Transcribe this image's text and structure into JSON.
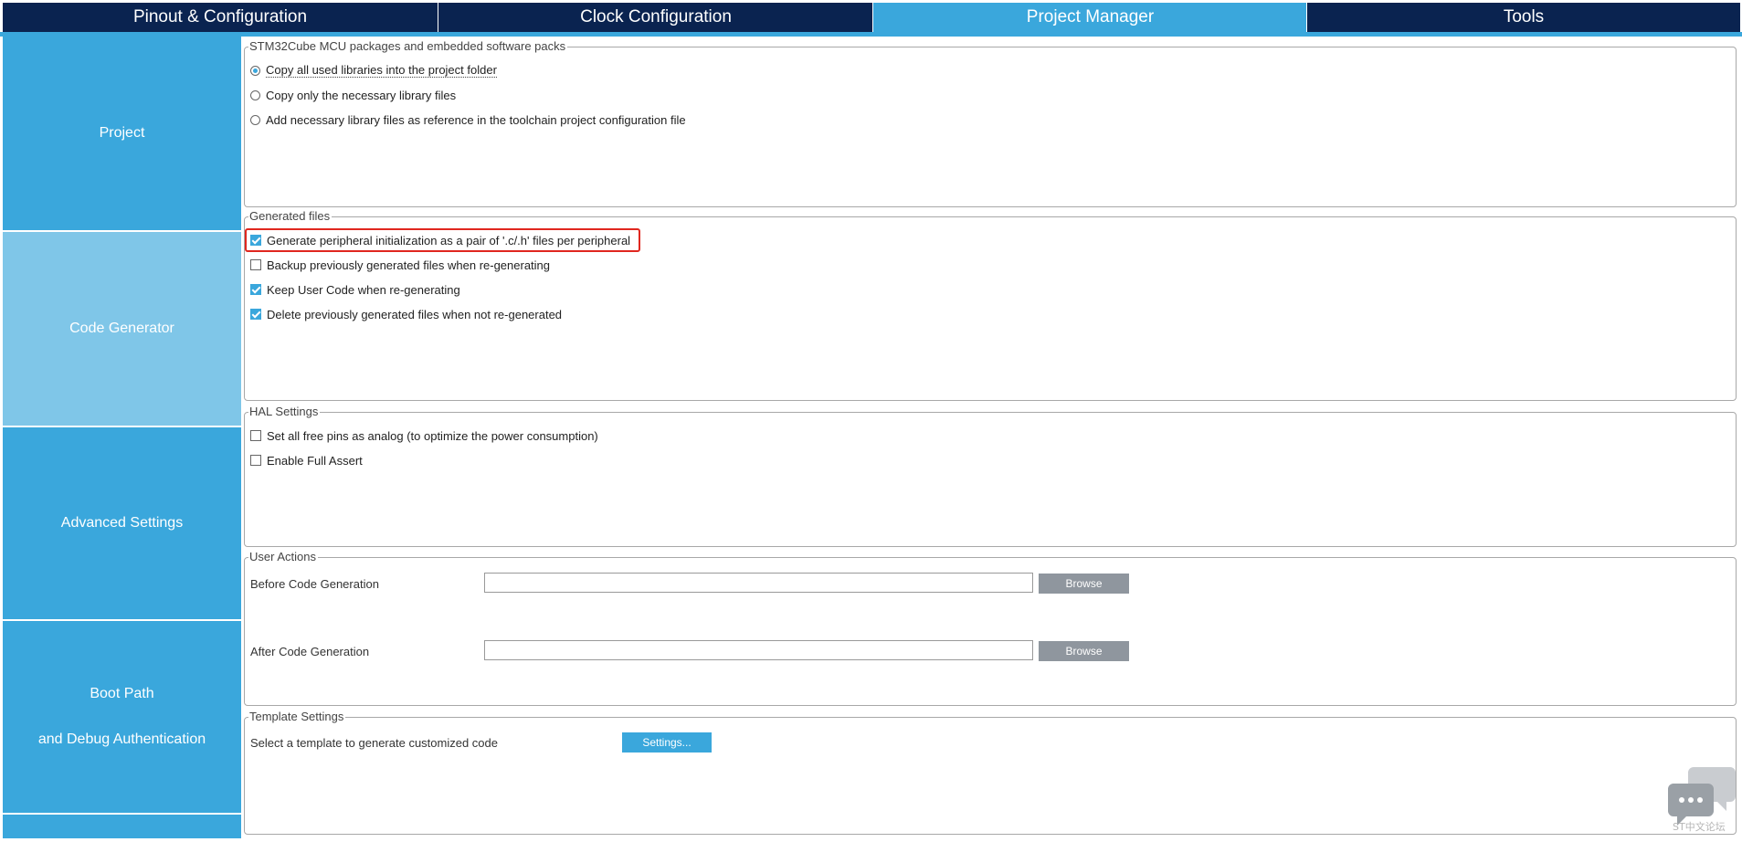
{
  "tabs": [
    {
      "label": "Pinout & Configuration",
      "active": false
    },
    {
      "label": "Clock Configuration",
      "active": false
    },
    {
      "label": "Project Manager",
      "active": true
    },
    {
      "label": "Tools",
      "active": false
    }
  ],
  "sidebar": {
    "items": [
      {
        "label": "Project",
        "active": false
      },
      {
        "label": "Code Generator",
        "active": true
      },
      {
        "label": "Advanced Settings",
        "active": false
      },
      {
        "label_line1": "Boot Path",
        "label_line2": "and Debug Authentication",
        "active": false
      }
    ]
  },
  "packages": {
    "legend": "STM32Cube MCU packages and embedded software packs",
    "options": [
      {
        "label": "Copy all used libraries into the project folder",
        "selected": true
      },
      {
        "label": "Copy only the necessary library files",
        "selected": false
      },
      {
        "label": "Add necessary library files as reference in the toolchain project configuration file",
        "selected": false
      }
    ]
  },
  "generated_files": {
    "legend": "Generated files",
    "options": [
      {
        "label": "Generate peripheral initialization as a pair of '.c/.h' files per peripheral",
        "checked": true,
        "highlighted": true
      },
      {
        "label": "Backup previously generated files when re-generating",
        "checked": false
      },
      {
        "label": "Keep User Code when re-generating",
        "checked": true
      },
      {
        "label": "Delete previously generated files when not re-generated",
        "checked": true
      }
    ]
  },
  "hal_settings": {
    "legend": "HAL Settings",
    "options": [
      {
        "label": "Set all free pins as analog (to optimize the power consumption)",
        "checked": false
      },
      {
        "label": "Enable Full Assert",
        "checked": false
      }
    ]
  },
  "user_actions": {
    "legend": "User Actions",
    "before_label": "Before Code Generation",
    "before_value": "",
    "after_label": "After Code Generation",
    "after_value": "",
    "browse_label": "Browse"
  },
  "template_settings": {
    "legend": "Template Settings",
    "label": "Select a template to generate customized code",
    "button_label": "Settings..."
  },
  "watermark": {
    "text": "ST中文论坛",
    "icon": "chat-bubbles-icon"
  },
  "colors": {
    "nav_dark": "#0a2350",
    "accent": "#3aa7dc",
    "active_nav": "#7fc6e8",
    "highlight": "#e0271f",
    "button_gray": "#8f969e"
  }
}
